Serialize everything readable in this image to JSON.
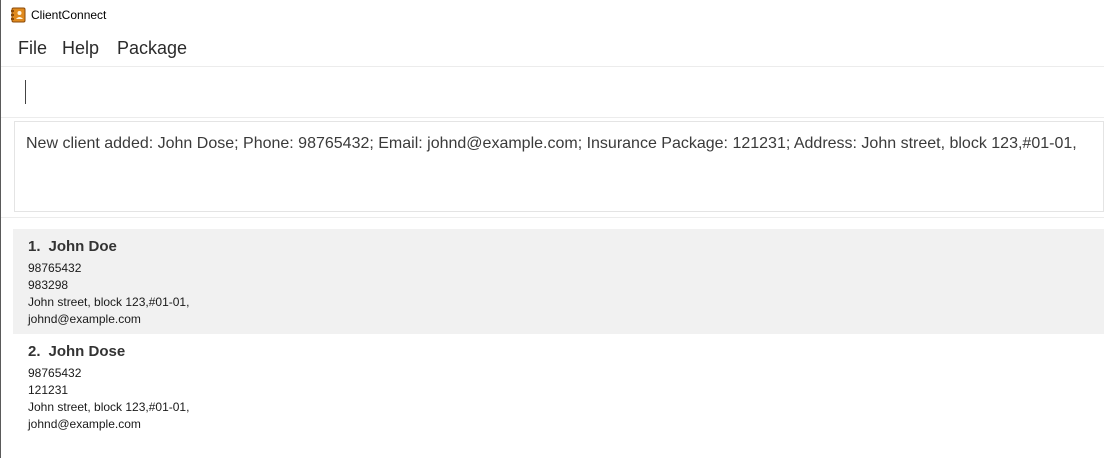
{
  "window": {
    "title": "ClientConnect",
    "icon": "address-book-icon"
  },
  "menu": {
    "items": [
      "File",
      "Help",
      "Package"
    ]
  },
  "command": {
    "value": ""
  },
  "result": {
    "text": "New client added: John Dose; Phone: 98765432; Email: johnd@example.com; Insurance Package: 121231; Address: John street, block 123,#01-01,"
  },
  "clients": [
    {
      "index": "1.",
      "name": "John Doe",
      "phone": "98765432",
      "package": "983298",
      "address": "John street, block 123,#01-01,",
      "email": "johnd@example.com"
    },
    {
      "index": "2.",
      "name": "John Dose",
      "phone": "98765432",
      "package": "121231",
      "address": "John street, block 123,#01-01,",
      "email": "johnd@example.com"
    }
  ],
  "colors": {
    "selected_row": "#f1f1f1",
    "icon": "#e08a1e"
  }
}
